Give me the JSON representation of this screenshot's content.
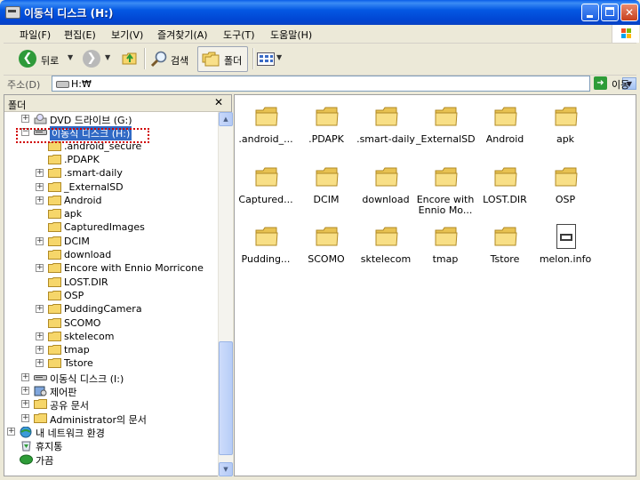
{
  "window": {
    "title": "이동식 디스크 (H:)"
  },
  "menu": [
    "파일(F)",
    "편집(E)",
    "보기(V)",
    "즐겨찾기(A)",
    "도구(T)",
    "도움말(H)"
  ],
  "toolbar": {
    "back_label": "뒤로",
    "search_label": "검색",
    "folders_label": "폴더"
  },
  "address": {
    "label": "주소(D)",
    "value": "H:₩",
    "go_label": "이동"
  },
  "folder_pane": {
    "title": "폴더",
    "close_glyph": "✕",
    "tree": [
      {
        "label": "DVD 드라이브 (G:)",
        "icon": "dvd-drive-icon",
        "expander": "+"
      },
      {
        "label": "이동식 디스크 (H:)",
        "icon": "removable-disk-icon",
        "expander": "−",
        "selected": true
      },
      {
        "label": ".android_secure",
        "icon": "folder-icon",
        "expander": ""
      },
      {
        "label": ".PDAPK",
        "icon": "folder-icon",
        "expander": ""
      },
      {
        "label": ".smart-daily",
        "icon": "folder-icon",
        "expander": "+"
      },
      {
        "label": "_ExternalSD",
        "icon": "folder-icon",
        "expander": "+"
      },
      {
        "label": "Android",
        "icon": "folder-icon",
        "expander": "+"
      },
      {
        "label": "apk",
        "icon": "folder-icon",
        "expander": ""
      },
      {
        "label": "CapturedImages",
        "icon": "folder-icon",
        "expander": ""
      },
      {
        "label": "DCIM",
        "icon": "folder-icon",
        "expander": "+"
      },
      {
        "label": "download",
        "icon": "folder-icon",
        "expander": ""
      },
      {
        "label": "Encore with Ennio Morricone",
        "icon": "folder-icon",
        "expander": "+"
      },
      {
        "label": "LOST.DIR",
        "icon": "folder-icon",
        "expander": ""
      },
      {
        "label": "OSP",
        "icon": "folder-icon",
        "expander": ""
      },
      {
        "label": "PuddingCamera",
        "icon": "folder-icon",
        "expander": "+"
      },
      {
        "label": "SCOMO",
        "icon": "folder-icon",
        "expander": ""
      },
      {
        "label": "sktelecom",
        "icon": "folder-icon",
        "expander": "+"
      },
      {
        "label": "tmap",
        "icon": "folder-icon",
        "expander": "+"
      },
      {
        "label": "Tstore",
        "icon": "folder-icon",
        "expander": "+"
      },
      {
        "label": "이동식 디스크 (I:)",
        "icon": "removable-disk-icon",
        "expander": "+"
      },
      {
        "label": "제어판",
        "icon": "control-panel-icon",
        "expander": "+"
      },
      {
        "label": "공유 문서",
        "icon": "folder-icon",
        "expander": "+"
      },
      {
        "label": "Administrator의 문서",
        "icon": "folder-icon",
        "expander": "+"
      },
      {
        "label": "내 네트워크 환경",
        "icon": "network-icon",
        "expander": "+"
      },
      {
        "label": "휴지통",
        "icon": "recycle-bin-icon",
        "expander": ""
      },
      {
        "label": "가끔",
        "icon": "green-icon",
        "expander": ""
      }
    ]
  },
  "content": {
    "items": [
      {
        "label": ".android_...",
        "type": "folder"
      },
      {
        "label": ".PDAPK",
        "type": "folder"
      },
      {
        "label": ".smart-daily",
        "type": "folder"
      },
      {
        "label": "_ExternalSD",
        "type": "folder"
      },
      {
        "label": "Android",
        "type": "folder"
      },
      {
        "label": "apk",
        "type": "folder"
      },
      {
        "label": "Captured...",
        "type": "folder"
      },
      {
        "label": "DCIM",
        "type": "folder"
      },
      {
        "label": "download",
        "type": "folder"
      },
      {
        "label": "Encore with\nEnnio Mo...",
        "type": "folder"
      },
      {
        "label": "LOST.DIR",
        "type": "folder"
      },
      {
        "label": "OSP",
        "type": "folder"
      },
      {
        "label": "Pudding...",
        "type": "folder"
      },
      {
        "label": "SCOMO",
        "type": "folder"
      },
      {
        "label": "sktelecom",
        "type": "folder"
      },
      {
        "label": "tmap",
        "type": "folder"
      },
      {
        "label": "Tstore",
        "type": "folder"
      },
      {
        "label": "melon.info",
        "type": "file"
      }
    ]
  },
  "colors": {
    "titlebar": "#0458e3",
    "selection": "#316ac5",
    "folder": "#f6d66a",
    "highlight_box": "#d00000"
  }
}
